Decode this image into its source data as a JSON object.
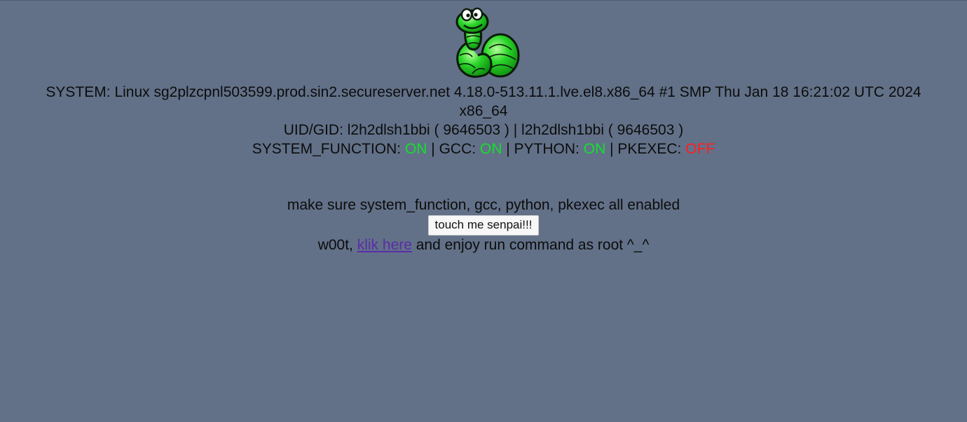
{
  "logo": {
    "icon": "green-worm-icon",
    "color": "#2ad52a"
  },
  "system": {
    "line1": "SYSTEM: Linux sg2plzcpnl503599.prod.sin2.secureserver.net 4.18.0-513.11.1.lve.el8.x86_64 #1 SMP Thu Jan 18 16:21:02 UTC 2024",
    "line2": "x86_64"
  },
  "uid_gid": "UID/GID: l2h2dlsh1bbi ( 9646503 ) | l2h2dlsh1bbi ( 9646503 )",
  "functions": {
    "system_function_label": "SYSTEM_FUNCTION: ",
    "system_function_value": "ON",
    "sep1": " | ",
    "gcc_label": "GCC: ",
    "gcc_value": "ON",
    "sep2": " | ",
    "python_label": "PYTHON: ",
    "python_value": "ON",
    "sep3": " | ",
    "pkexec_label": "PKEXEC: ",
    "pkexec_value": "OFF",
    "on_color": "#14e02c",
    "off_color": "#ff1e1e"
  },
  "instruction": "make sure system_function, gcc, python, pkexec all enabled",
  "button_label": "touch me senpai!!!",
  "result": {
    "prefix": "w00t, ",
    "link_text": "klik here",
    "suffix": " and enjoy run command as root ^_^"
  }
}
